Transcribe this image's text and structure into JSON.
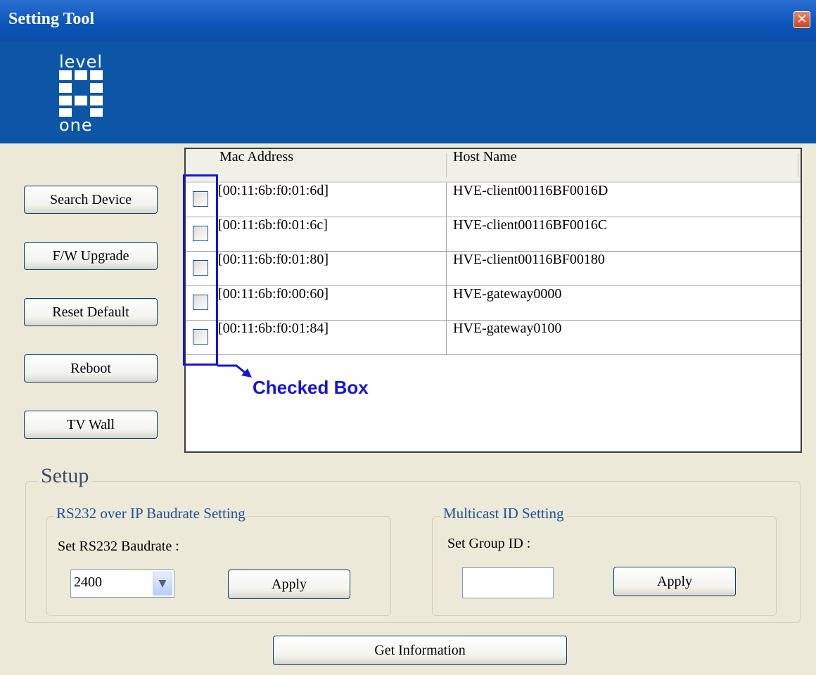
{
  "window": {
    "title": "Setting Tool",
    "close_glyph": "✕",
    "icon_close": "close-icon"
  },
  "logo": {
    "top_text": "level",
    "bottom_text": "one"
  },
  "sidebar": {
    "buttons": [
      {
        "label": "Search Device"
      },
      {
        "label": "F/W Upgrade"
      },
      {
        "label": "Reset Default"
      },
      {
        "label": "Reboot"
      },
      {
        "label": "TV Wall"
      }
    ]
  },
  "device_list": {
    "columns": [
      "Mac Address",
      "Host Name"
    ],
    "rows": [
      {
        "checked": false,
        "mac": "[00:11:6b:f0:01:6d]",
        "host": "HVE-client00116BF0016D"
      },
      {
        "checked": false,
        "mac": "[00:11:6b:f0:01:6c]",
        "host": "HVE-client00116BF0016C"
      },
      {
        "checked": false,
        "mac": "[00:11:6b:f0:01:80]",
        "host": "HVE-client00116BF00180"
      },
      {
        "checked": false,
        "mac": "[00:11:6b:f0:00:60]",
        "host": "HVE-gateway0000"
      },
      {
        "checked": false,
        "mac": "[00:11:6b:f0:01:84]",
        "host": "HVE-gateway0100"
      }
    ]
  },
  "annotation": {
    "label": "Checked Box",
    "color": "#1515d8"
  },
  "setup": {
    "title": "Setup",
    "rs232": {
      "title": "RS232 over IP Baudrate Setting",
      "label": "Set RS232 Baudrate :",
      "selected": "2400",
      "apply_label": "Apply"
    },
    "multicast": {
      "title": "Multicast ID Setting",
      "label": "Set Group ID :",
      "value": "",
      "apply_label": "Apply"
    }
  },
  "footer": {
    "get_info_label": "Get Information"
  },
  "colors": {
    "titlebar": "#0b55b8",
    "header": "#0d56a6",
    "window_bg": "#ece9d8",
    "group_title": "#1f4f9a"
  }
}
